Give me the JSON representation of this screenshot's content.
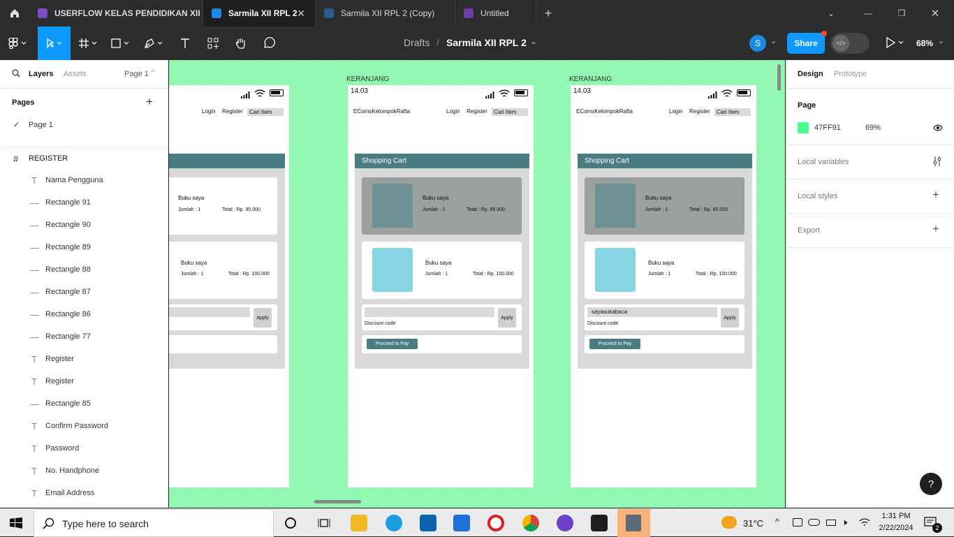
{
  "browser_tabs": [
    {
      "label": "USERFLOW KELAS PENDIDIKAN XII R",
      "active": false
    },
    {
      "label": "Sarmila XII RPL 2",
      "active": true
    },
    {
      "label": "Sarmila XII RPL 2 (Copy)",
      "active": false
    },
    {
      "label": "Untitled",
      "active": false
    }
  ],
  "toolbar": {
    "breadcrumb_root": "Drafts",
    "separator": "/",
    "file_name": "Sarmila XII RPL 2",
    "avatar_initial": "S",
    "share_label": "Share",
    "zoom": "68%"
  },
  "left_panel": {
    "tab_layers": "Layers",
    "tab_assets": "Assets",
    "page_selector": "Page 1",
    "pages_heading": "Pages",
    "pages": [
      "Page 1"
    ],
    "frame_name": "REGISTER",
    "layers": [
      {
        "type": "text",
        "name": "Nama Pengguna"
      },
      {
        "type": "rect",
        "name": "Rectangle 91"
      },
      {
        "type": "rect",
        "name": "Rectangle 90"
      },
      {
        "type": "rect",
        "name": "Rectangle 89"
      },
      {
        "type": "rect",
        "name": "Rectangle 88"
      },
      {
        "type": "rect",
        "name": "Rectangle 87"
      },
      {
        "type": "rect",
        "name": "Rectangle 86"
      },
      {
        "type": "rect",
        "name": "Rectangle 77"
      },
      {
        "type": "text",
        "name": "Register"
      },
      {
        "type": "text",
        "name": "Register"
      },
      {
        "type": "rect",
        "name": "Rectangle 85"
      },
      {
        "type": "text",
        "name": "Confirm Password"
      },
      {
        "type": "text",
        "name": "Password"
      },
      {
        "type": "text",
        "name": "No. Handphone"
      },
      {
        "type": "text",
        "name": "Email Address"
      }
    ]
  },
  "canvas": {
    "background_color": "#8EF7B0",
    "frames": [
      {
        "label": "",
        "time": "",
        "brand": "Rafta",
        "nav_login": "Login",
        "nav_register": "Register",
        "search": "Cari Item",
        "header": "art",
        "items": [
          {
            "title": "Buku saya",
            "qty": "Jumlah :  1",
            "total": "Total : Rp. 95.000"
          },
          {
            "title": "Buku saya",
            "qty": "Jumlah :  1",
            "total": "Total : Rp. 100.000"
          }
        ],
        "apply": "Apply",
        "discount_label": "",
        "discount_value": "",
        "pay": "Pay"
      },
      {
        "label": "KERANJANG",
        "time": "14.03",
        "brand": "EComsKelompokRafta",
        "nav_login": "Login",
        "nav_register": "Register",
        "search": "Cari Item",
        "header": "Shopping Cart",
        "items": [
          {
            "title": "Buku saya",
            "qty": "Jumlah :  1",
            "total": "Total : Rp. 95.000"
          },
          {
            "title": "Buku saya",
            "qty": "Jumlah :  1",
            "total": "Total : Rp. 100.000"
          }
        ],
        "apply": "Apply",
        "discount_label": "Discount code",
        "discount_value": "",
        "pay": "Proceed to Pay"
      },
      {
        "label": "KERANJANG",
        "time": "14.03",
        "brand": "EComsKelompokRafta",
        "nav_login": "Login",
        "nav_register": "Register",
        "search": "Cari Item",
        "header": "Shopping Cart",
        "items": [
          {
            "title": "Buku saya",
            "qty": "Jumlah :  1",
            "total": "Total : Rp. 95.000"
          },
          {
            "title": "Buku saya",
            "qty": "Jumlah :  1",
            "total": "Total : Rp. 100.000"
          }
        ],
        "apply": "Apply",
        "discount_label": "Discount code",
        "discount_value": "sayasukabaca",
        "pay": "Proceed to Pay"
      }
    ]
  },
  "right_panel": {
    "tab_design": "Design",
    "tab_prototype": "Prototype",
    "page_heading": "Page",
    "page_color_hex": "47FF91",
    "page_color": "#47FF91",
    "page_opacity": "69%",
    "local_variables": "Local variables",
    "local_styles": "Local styles",
    "export": "Export",
    "help": "?"
  },
  "taskbar": {
    "search_placeholder": "Type here to search",
    "weather": "31°C",
    "time": "1:31 PM",
    "date": "2/22/2024",
    "notifications": "2"
  }
}
